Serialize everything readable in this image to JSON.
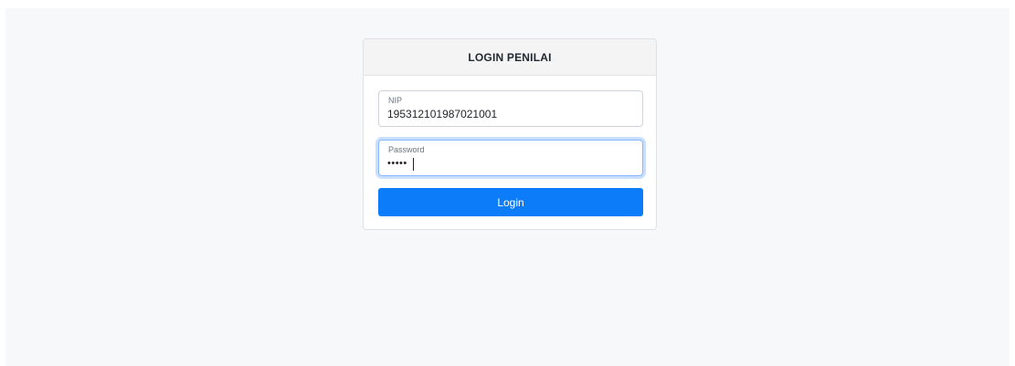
{
  "login_card": {
    "title": "LOGIN PENILAI",
    "nip_field": {
      "label": "NIP",
      "value": "195312101987021001"
    },
    "password_field": {
      "label": "Password",
      "value": "•••••"
    },
    "login_button_label": "Login"
  },
  "colors": {
    "page_background": "#f7f8fa",
    "card_header_background": "#f4f4f5",
    "primary_button": "#0d7cf8",
    "focus_border": "#86b7fe"
  }
}
